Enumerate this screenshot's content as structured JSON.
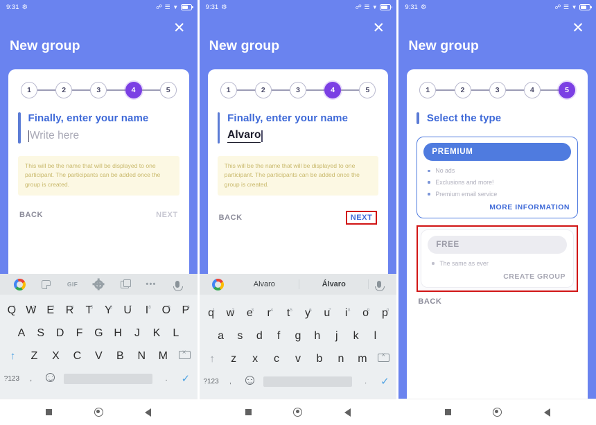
{
  "status_bar": {
    "time": "9:31",
    "left_icons": [
      "settings-gear-icon"
    ],
    "right_icons": [
      "bluetooth-icon",
      "signal-icon",
      "wifi-icon",
      "battery-icon"
    ]
  },
  "header": {
    "title": "New group",
    "close_label": "✕"
  },
  "colors": {
    "brand_blue": "#6a83ef",
    "accent_blue": "#3f6ad8",
    "active_step_purple": "#7b3fe4",
    "highlight_red": "#d11515",
    "note_bg": "#fcf8e3"
  },
  "panels": [
    {
      "id": "panel-1",
      "stepper": {
        "steps": [
          "1",
          "2",
          "3",
          "4",
          "5"
        ],
        "active": "4"
      },
      "question": {
        "title": "Finally, enter your name",
        "input_value": "",
        "input_placeholder": "Write here"
      },
      "note": "This will be the name that will be displayed to one participant. The participants can be added once the group is created.",
      "actions": {
        "back": "BACK",
        "next": "NEXT",
        "next_state": "disabled",
        "next_highlighted": false
      },
      "keyboard": {
        "toolbar_icons": [
          "google-logo-icon",
          "sticker-icon",
          "gif-icon",
          "gear-icon",
          "clipboard-icon",
          "more-dots-icon",
          "mic-icon"
        ],
        "gif_label": "GIF",
        "more_label": "•••",
        "shift_active": true,
        "rows": [
          [
            "Q",
            "W",
            "E",
            "R",
            "T",
            "Y",
            "U",
            "I",
            "O",
            "P"
          ],
          [
            "A",
            "S",
            "D",
            "F",
            "G",
            "H",
            "J",
            "K",
            "L"
          ],
          [
            "Z",
            "X",
            "C",
            "V",
            "B",
            "N",
            "M"
          ]
        ],
        "number_row": [
          "1",
          "2",
          "3",
          "4",
          "5",
          "6",
          "7",
          "8",
          "9",
          "0"
        ],
        "symbols_key": "?123",
        "comma_key": ",",
        "period_key": ".",
        "emoji_key": "emoji-icon",
        "enter_key": "check-icon",
        "backspace_key": "backspace-icon"
      }
    },
    {
      "id": "panel-2",
      "stepper": {
        "steps": [
          "1",
          "2",
          "3",
          "4",
          "5"
        ],
        "active": "4"
      },
      "question": {
        "title": "Finally, enter your name",
        "input_value": "Alvaro",
        "input_placeholder": "Write here"
      },
      "note": "This will be the name that will be displayed to one participant. The participants can be added once the group is created.",
      "actions": {
        "back": "BACK",
        "next": "NEXT",
        "next_state": "enabled",
        "next_highlighted": true
      },
      "keyboard": {
        "suggestions": [
          "Alvaro",
          "Álvaro"
        ],
        "suggestion_bold_index": 1,
        "shift_active": false,
        "rows": [
          [
            "q",
            "w",
            "e",
            "r",
            "t",
            "y",
            "u",
            "i",
            "o",
            "p"
          ],
          [
            "a",
            "s",
            "d",
            "f",
            "g",
            "h",
            "j",
            "k",
            "l"
          ],
          [
            "z",
            "x",
            "c",
            "v",
            "b",
            "n",
            "m"
          ]
        ],
        "number_row": [
          "1",
          "2",
          "3",
          "4",
          "5",
          "6",
          "7",
          "8",
          "9",
          "0"
        ],
        "symbols_key": "?123",
        "comma_key": ",",
        "period_key": ".",
        "emoji_key": "emoji-icon",
        "enter_key": "check-icon",
        "backspace_key": "backspace-icon"
      }
    },
    {
      "id": "panel-3",
      "stepper": {
        "steps": [
          "1",
          "2",
          "3",
          "4",
          "5"
        ],
        "active": "5"
      },
      "question": {
        "title": "Select the type"
      },
      "plans": [
        {
          "name": "PREMIUM",
          "features": [
            "No ads",
            "Exclusions and more!",
            "Premium email service"
          ],
          "cta": "MORE INFORMATION",
          "selected": true,
          "highlighted": false
        },
        {
          "name": "FREE",
          "features": [
            "The same as ever"
          ],
          "cta": "CREATE GROUP",
          "selected": false,
          "highlighted": true
        }
      ],
      "actions": {
        "back": "BACK"
      }
    }
  ],
  "navbar": {
    "items": [
      "recents-square-icon",
      "home-circle-icon",
      "back-triangle-icon"
    ]
  }
}
